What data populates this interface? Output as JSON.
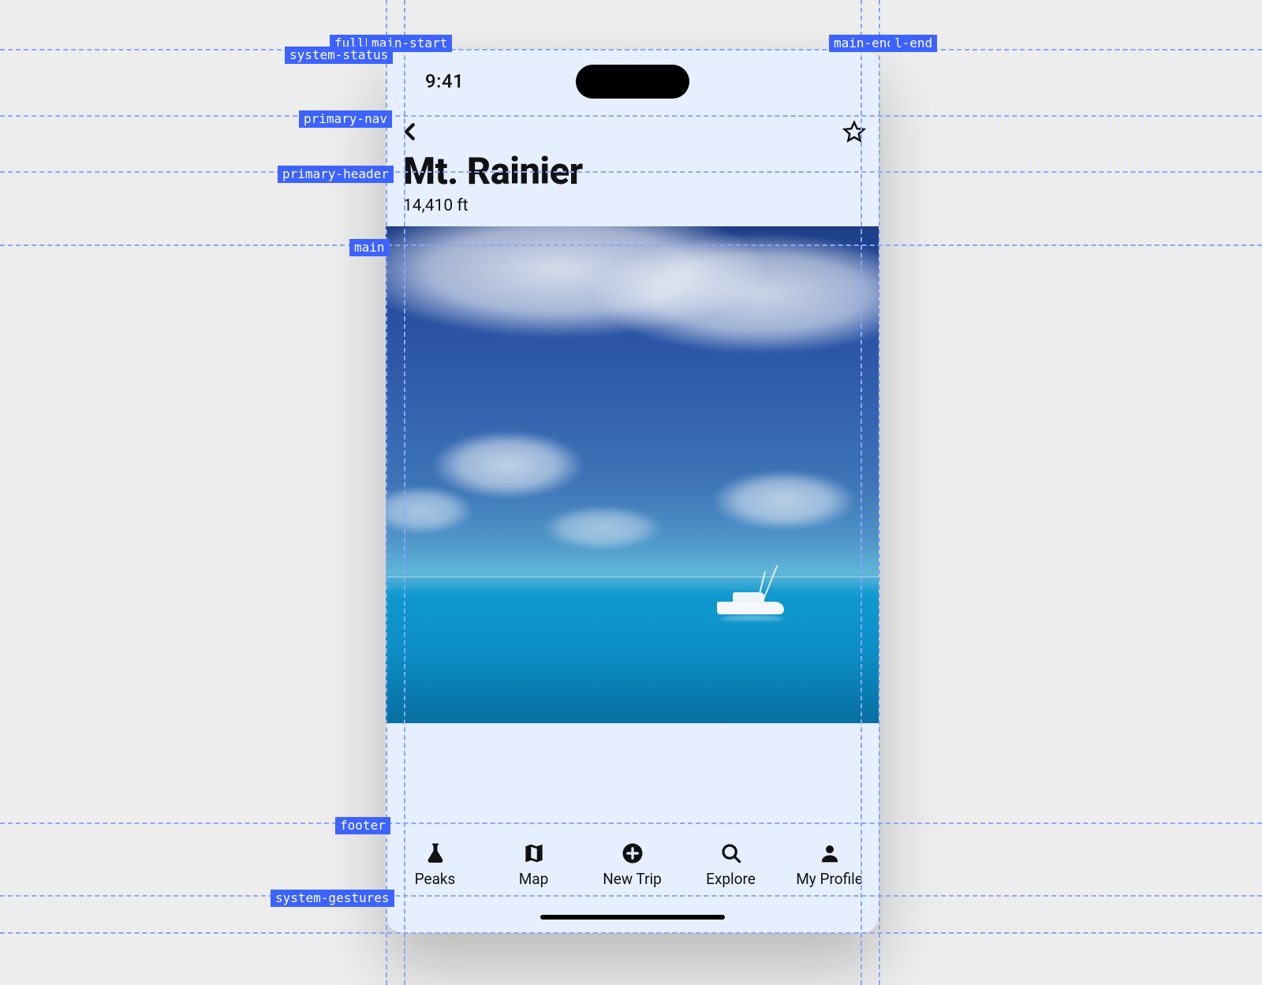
{
  "status": {
    "time": "9:41"
  },
  "header": {
    "title": "Mt. Rainier",
    "subtitle": "14,410 ft"
  },
  "tabs": [
    {
      "label": "Peaks"
    },
    {
      "label": "Map"
    },
    {
      "label": "New Trip"
    },
    {
      "label": "Explore"
    },
    {
      "label": "My Profile"
    }
  ],
  "guideLabels": {
    "fullb": "fullb",
    "mainStart": "main-start",
    "mainEnd": "main-end",
    "lEnd": "l-end",
    "systemStatus": "system-status",
    "primaryNav": "primary-nav",
    "primaryHeader": "primary-header",
    "main": "main",
    "footer": "footer",
    "systemGestures": "system-gestures"
  }
}
